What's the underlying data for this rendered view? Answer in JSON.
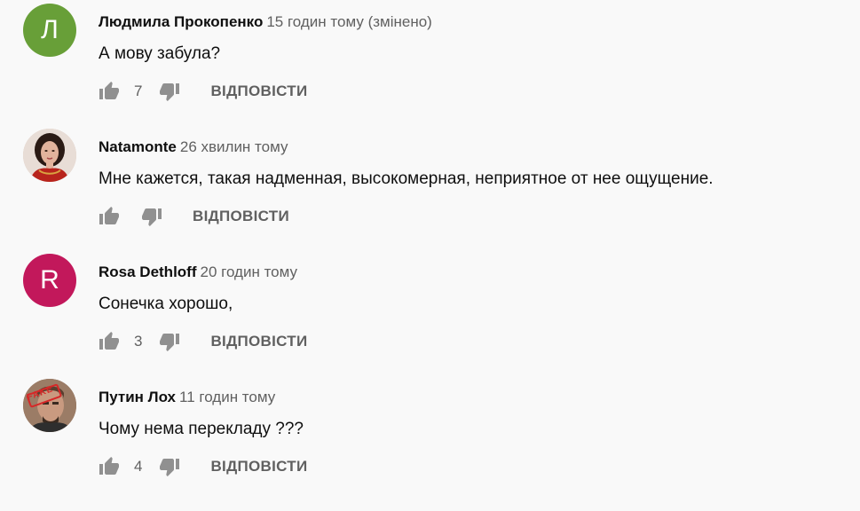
{
  "reply_label": "ВІДПОВІСТИ",
  "comments": [
    {
      "author": "Людмила Прокопенко",
      "time": "15 годин тому (змінено)",
      "text": "А мову забула?",
      "likes": "7",
      "avatar": {
        "type": "letter",
        "letter": "Л",
        "color": "#689f38"
      }
    },
    {
      "author": "Natamonte",
      "time": "26 хвилин тому",
      "text": "Мне кажется, такая надменная, высокомерная, неприятное от нее ощущение.",
      "likes": "",
      "avatar": {
        "type": "photo",
        "icon": "woman-portrait-icon"
      }
    },
    {
      "author": "Rosa Dethloff",
      "time": "20 годин тому",
      "text": "Сонечка хорошо,",
      "likes": "3",
      "avatar": {
        "type": "letter",
        "letter": "R",
        "color": "#c2185b"
      }
    },
    {
      "author": "Путин Лох",
      "time": "11 годин тому",
      "text": "Чому нема перекладу ???",
      "likes": "4",
      "avatar": {
        "type": "photo",
        "icon": "fake-stamp-portrait-icon",
        "stamp_text": "FAKE"
      }
    }
  ]
}
